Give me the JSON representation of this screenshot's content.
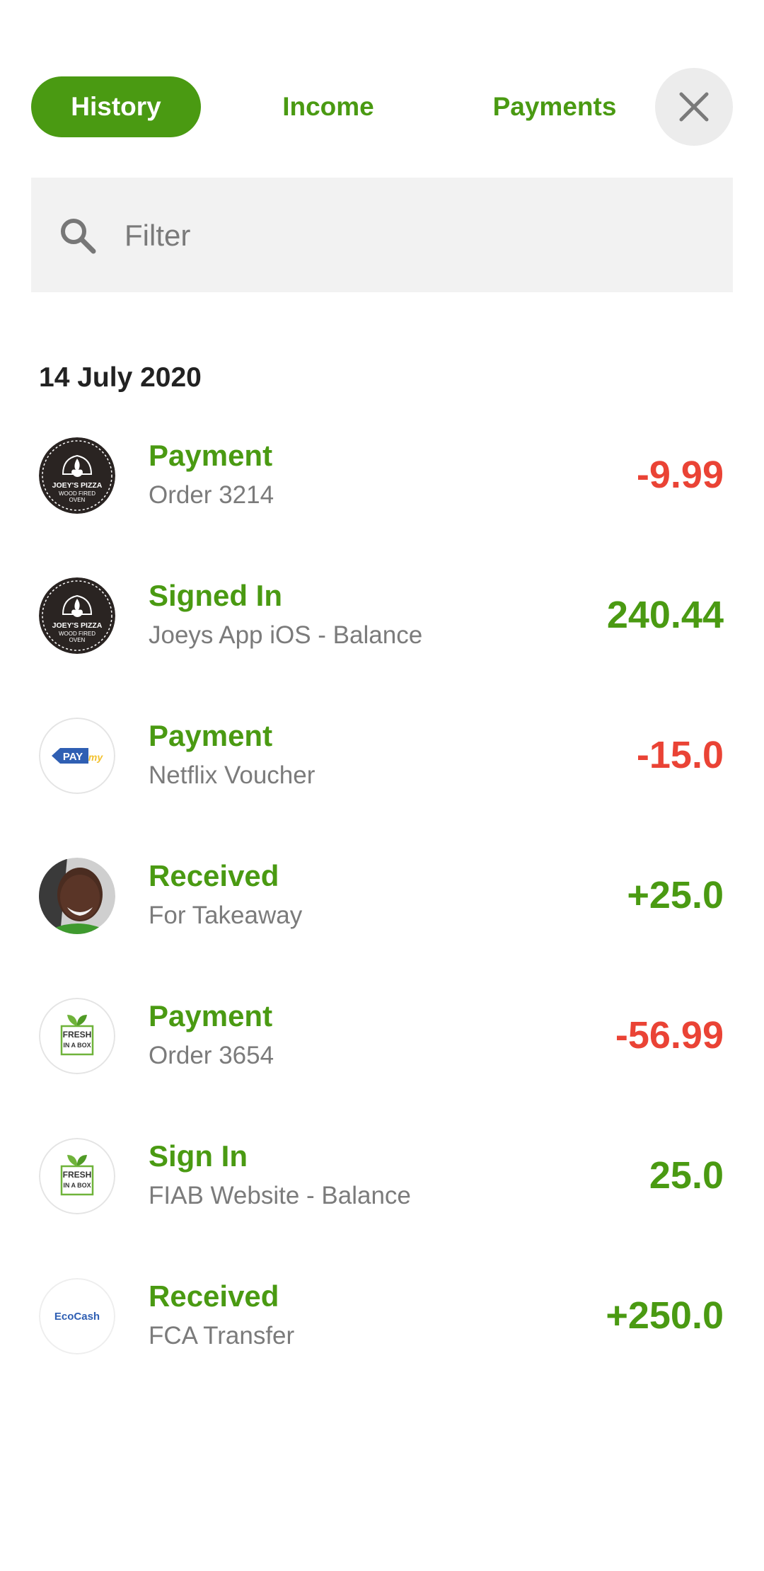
{
  "tabs": [
    {
      "label": "History",
      "active": true
    },
    {
      "label": "Income",
      "active": false
    },
    {
      "label": "Payments",
      "active": false
    }
  ],
  "close_icon": "close-icon",
  "filter": {
    "placeholder": "Filter",
    "value": "",
    "icon": "search-icon"
  },
  "date_header": "14 July 2020",
  "transactions": [
    {
      "title": "Payment",
      "subtitle": "Order 3214",
      "amount": "-9.99",
      "avatar": "joeys-pizza-logo",
      "avatar_text": [
        "JOEY'S PIZZA",
        "WOOD FIRED",
        "OVEN"
      ]
    },
    {
      "title": "Signed In",
      "subtitle": "Joeys App iOS - Balance",
      "amount": "240.44",
      "avatar": "joeys-pizza-logo",
      "avatar_text": [
        "JOEY'S PIZZA",
        "WOOD FIRED",
        "OVEN"
      ]
    },
    {
      "title": "Payment",
      "subtitle": "Netflix Voucher",
      "amount": "-15.0",
      "avatar": "paymy-logo",
      "avatar_text": [
        "PAY",
        "my"
      ]
    },
    {
      "title": "Received",
      "subtitle": "For Takeaway",
      "amount": "+25.0",
      "avatar": "user-photo"
    },
    {
      "title": "Payment",
      "subtitle": "Order 3654",
      "amount": "-56.99",
      "avatar": "fresh-in-a-box-logo",
      "avatar_text": [
        "FRESH",
        "IN A BOX"
      ]
    },
    {
      "title": "Sign In",
      "subtitle": "FIAB Website - Balance",
      "amount": "25.0",
      "avatar": "fresh-in-a-box-logo",
      "avatar_text": [
        "FRESH",
        "IN A BOX"
      ]
    },
    {
      "title": "Received",
      "subtitle": "FCA Transfer",
      "amount": "+250.0",
      "avatar": "ecocash-logo",
      "avatar_text": [
        "EcoCash"
      ]
    }
  ],
  "colors": {
    "accent_green": "#4a9a12",
    "negative_red": "#ea4335",
    "subtitle_gray": "#7b7b7b",
    "filter_bg": "#f2f2f2",
    "close_bg": "#ececec"
  }
}
